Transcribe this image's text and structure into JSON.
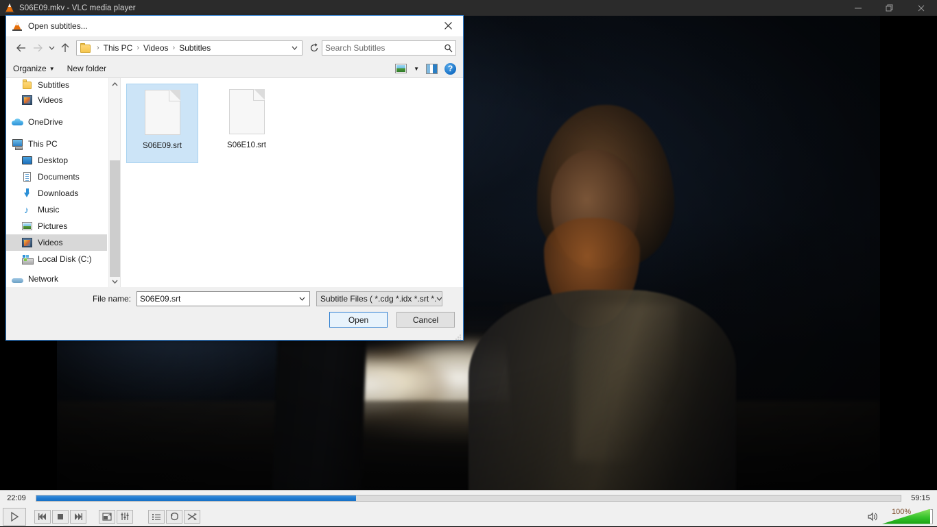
{
  "player": {
    "window_title": "S06E09.mkv - VLC media player",
    "app_icon": "vlc-cone-icon",
    "window_buttons": {
      "minimize": "minimize-icon",
      "restore": "restore-icon",
      "close": "close-icon"
    },
    "seek": {
      "elapsed": "22:09",
      "total": "59:15",
      "progress_percent": 37,
      "fill_color": "#1f7ad0",
      "track_color": "#dcdcdc"
    },
    "controls": [
      {
        "name": "play-button",
        "icon": "play-icon"
      },
      {
        "name": "previous-button",
        "icon": "previous-icon"
      },
      {
        "name": "stop-button",
        "icon": "stop-icon"
      },
      {
        "name": "next-button",
        "icon": "next-icon"
      },
      {
        "name": "fullscreen-button",
        "icon": "fullscreen-icon"
      },
      {
        "name": "equalizer-button",
        "icon": "equalizer-icon"
      },
      {
        "name": "playlist-button",
        "icon": "playlist-icon"
      },
      {
        "name": "loop-button",
        "icon": "loop-icon"
      },
      {
        "name": "shuffle-button",
        "icon": "shuffle-icon"
      }
    ],
    "volume": {
      "label": "100%",
      "percent": 100,
      "icon": "speaker-icon",
      "fill_color": "#35c32b"
    }
  },
  "dialog": {
    "title": "Open subtitles...",
    "icon": "vlc-cone-icon",
    "close_label": "close-icon",
    "nav": {
      "back": "back-arrow-icon",
      "forward": "forward-arrow-icon",
      "recent": "chevron-down-icon",
      "up": "up-arrow-icon",
      "refresh": "refresh-icon",
      "breadcrumb": [
        "This PC",
        "Videos",
        "Subtitles"
      ],
      "breadcrumb_separator": "›",
      "folder_icon": "folder-icon",
      "dropdown": "chevron-down-icon"
    },
    "search": {
      "placeholder": "Search Subtitles",
      "value": "",
      "icon": "search-icon"
    },
    "toolbar": {
      "organize": "Organize",
      "organize_caret": "▼",
      "new_folder": "New folder",
      "view_icon": "view-layout-icon",
      "view_caret": "▼",
      "preview_pane_icon": "preview-pane-icon",
      "help_icon": "help-icon",
      "help_label": "?"
    },
    "sidebar": {
      "items": [
        {
          "label": "Subtitles",
          "icon": "folder-icon",
          "indent": 1,
          "selected": false
        },
        {
          "label": "Videos",
          "icon": "video-folder-icon",
          "indent": 1,
          "selected": false
        },
        {
          "label": "OneDrive",
          "icon": "onedrive-icon",
          "indent": 0,
          "selected": false
        },
        {
          "label": "This PC",
          "icon": "this-pc-icon",
          "indent": 0,
          "selected": false
        },
        {
          "label": "Desktop",
          "icon": "desktop-icon",
          "indent": 1,
          "selected": false
        },
        {
          "label": "Documents",
          "icon": "documents-icon",
          "indent": 1,
          "selected": false
        },
        {
          "label": "Downloads",
          "icon": "downloads-icon",
          "indent": 1,
          "selected": false
        },
        {
          "label": "Music",
          "icon": "music-icon",
          "indent": 1,
          "selected": false
        },
        {
          "label": "Pictures",
          "icon": "pictures-icon",
          "indent": 1,
          "selected": false
        },
        {
          "label": "Videos",
          "icon": "video-folder-icon",
          "indent": 1,
          "selected": true
        },
        {
          "label": "Local Disk (C:)",
          "icon": "local-disk-icon",
          "indent": 1,
          "selected": false
        },
        {
          "label": "Network",
          "icon": "network-icon",
          "indent": 0,
          "selected": false
        }
      ],
      "scrollbar": {
        "up_arrow": "chevron-up-icon",
        "down_arrow": "chevron-down-icon"
      }
    },
    "files": [
      {
        "name": "S06E09.srt",
        "icon": "generic-file-icon",
        "selected": true
      },
      {
        "name": "S06E10.srt",
        "icon": "generic-file-icon",
        "selected": false
      }
    ],
    "footer": {
      "filename_label": "File name:",
      "filename_value": "S06E09.srt",
      "filename_caret": "⌄",
      "filter_value": "Subtitle Files ( *.cdg *.idx *.srt *.",
      "filter_caret": "⌄",
      "open_button": "Open",
      "cancel_button": "Cancel",
      "accent_color": "#2f7fd1"
    }
  }
}
